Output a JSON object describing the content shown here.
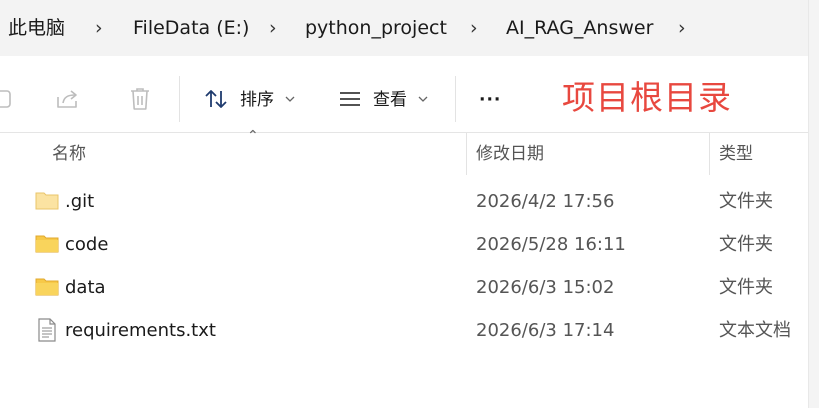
{
  "breadcrumb": {
    "items": [
      "此电脑",
      "FileData (E:)",
      "python_project",
      "AI_RAG_Answer"
    ]
  },
  "toolbar": {
    "sort_label": "排序",
    "view_label": "查看",
    "more_label": "···",
    "annotation": "项目根目录"
  },
  "columns": {
    "name": "名称",
    "date": "修改日期",
    "type": "类型"
  },
  "files": [
    {
      "name": ".git",
      "date": "2026/4/2 17:56",
      "type": "文件夹",
      "icon": "folder-icon"
    },
    {
      "name": "code",
      "date": "2026/5/28 16:11",
      "type": "文件夹",
      "icon": "folder-icon"
    },
    {
      "name": "data",
      "date": "2026/6/3 15:02",
      "type": "文件夹",
      "icon": "folder-icon"
    },
    {
      "name": "requirements.txt",
      "date": "2026/6/3 17:14",
      "type": "文本文档",
      "icon": "text-file-icon"
    }
  ],
  "colors": {
    "annotation": "#e8483f",
    "folder": "#f7c948"
  }
}
